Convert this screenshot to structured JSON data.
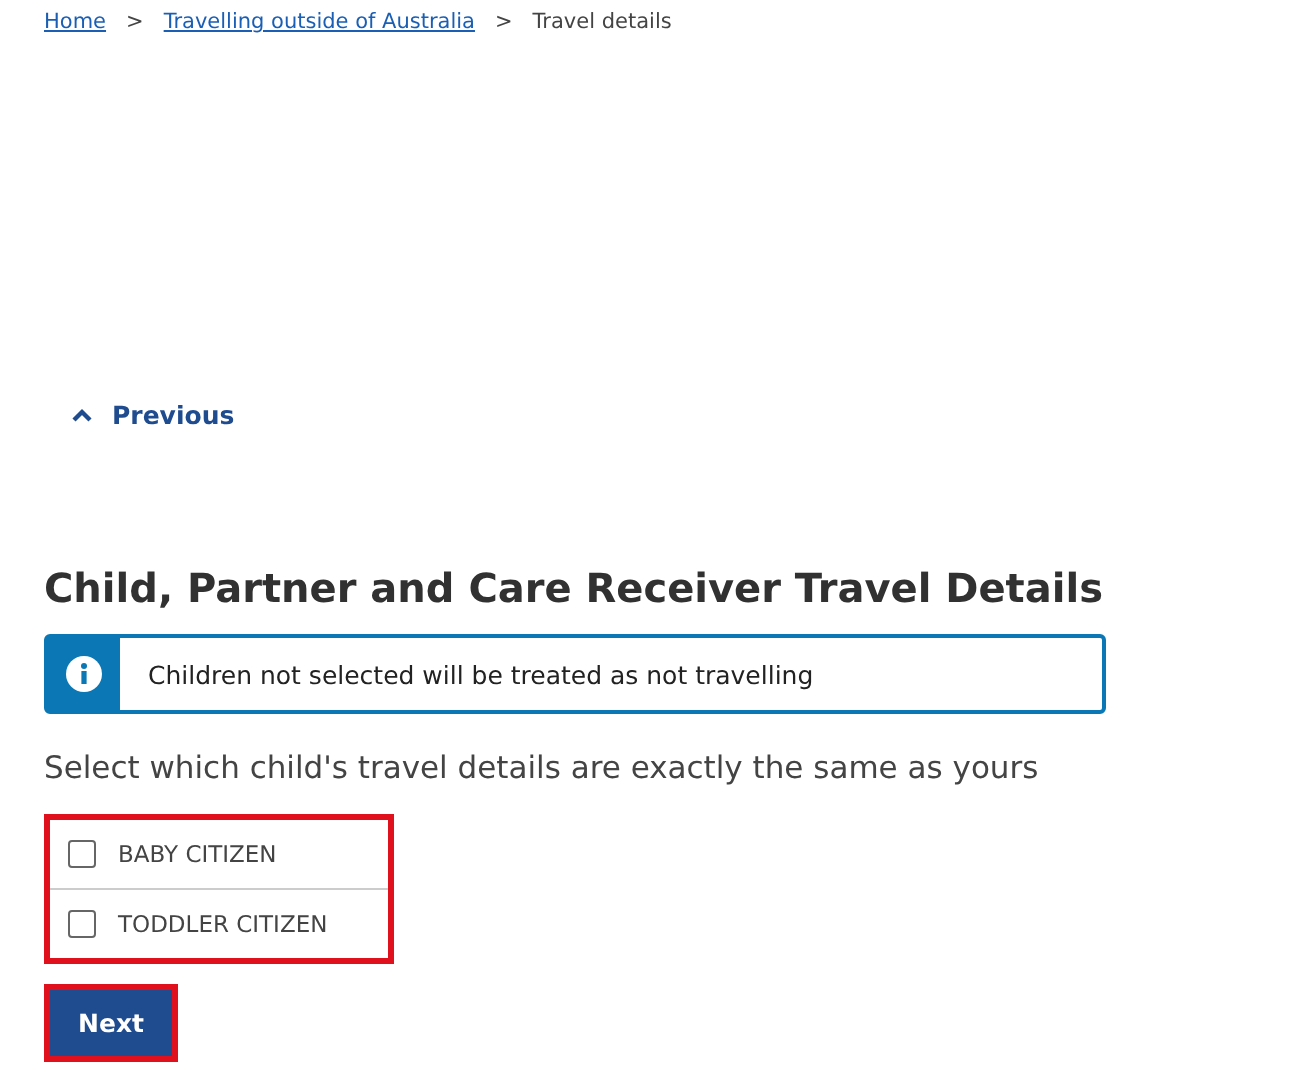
{
  "breadcrumb": [
    {
      "label": "Home",
      "link": true
    },
    {
      "label": "Travelling outside of Australia",
      "link": true
    },
    {
      "label": "Travel details",
      "link": false
    }
  ],
  "breadcrumb_separator": ">",
  "previous": {
    "label": "Previous"
  },
  "heading": "Child, Partner and Care Receiver Travel Details",
  "info": {
    "text": "Children not selected will be treated as not travelling"
  },
  "question": "Select which child's travel details are exactly the same as yours",
  "children": {
    "highlighted": true,
    "items": [
      {
        "label": "BABY CITIZEN",
        "checked": false
      },
      {
        "label": "TODDLER CITIZEN",
        "checked": false
      }
    ]
  },
  "next_button": {
    "label": "Next",
    "highlighted": true
  }
}
